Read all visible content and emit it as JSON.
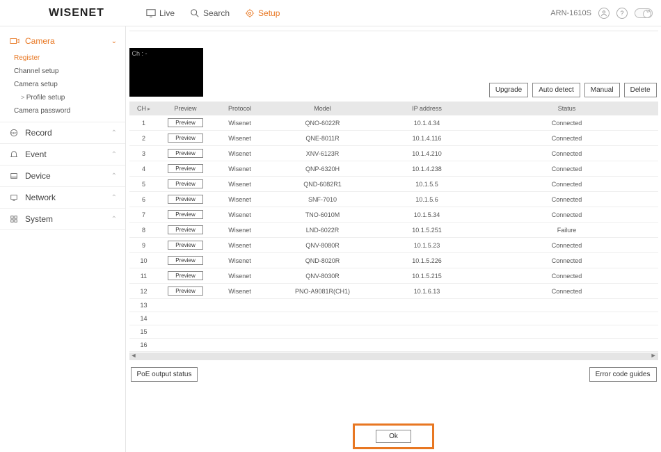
{
  "header": {
    "logo": "WISENET",
    "tabs": {
      "live": "Live",
      "search": "Search",
      "setup": "Setup"
    },
    "device": "ARN-1610S"
  },
  "sidebar": {
    "camera": {
      "label": "Camera",
      "register": "Register",
      "channel_setup": "Channel setup",
      "camera_setup": "Camera setup",
      "profile_setup": "Profile setup",
      "camera_password": "Camera password"
    },
    "record": "Record",
    "event": "Event",
    "device": "Device",
    "network": "Network",
    "system": "System"
  },
  "preview_box_label": "Ch : -",
  "toolbar": {
    "upgrade": "Upgrade",
    "auto_detect": "Auto detect",
    "manual": "Manual",
    "delete": "Delete"
  },
  "table": {
    "headers": {
      "ch": "CH",
      "preview": "Preview",
      "protocol": "Protocol",
      "model": "Model",
      "ip": "IP address",
      "status": "Status"
    },
    "preview_btn": "Preview",
    "rows": [
      {
        "ch": "1",
        "protocol": "Wisenet",
        "model": "QNO-6022R",
        "ip": "10.1.4.34",
        "status": "Connected"
      },
      {
        "ch": "2",
        "protocol": "Wisenet",
        "model": "QNE-8011R",
        "ip": "10.1.4.116",
        "status": "Connected"
      },
      {
        "ch": "3",
        "protocol": "Wisenet",
        "model": "XNV-6123R",
        "ip": "10.1.4.210",
        "status": "Connected"
      },
      {
        "ch": "4",
        "protocol": "Wisenet",
        "model": "QNP-6320H",
        "ip": "10.1.4.238",
        "status": "Connected"
      },
      {
        "ch": "5",
        "protocol": "Wisenet",
        "model": "QND-6082R1",
        "ip": "10.1.5.5",
        "status": "Connected"
      },
      {
        "ch": "6",
        "protocol": "Wisenet",
        "model": "SNF-7010",
        "ip": "10.1.5.6",
        "status": "Connected"
      },
      {
        "ch": "7",
        "protocol": "Wisenet",
        "model": "TNO-6010M",
        "ip": "10.1.5.34",
        "status": "Connected"
      },
      {
        "ch": "8",
        "protocol": "Wisenet",
        "model": "LND-6022R",
        "ip": "10.1.5.251",
        "status": "Failure"
      },
      {
        "ch": "9",
        "protocol": "Wisenet",
        "model": "QNV-8080R",
        "ip": "10.1.5.23",
        "status": "Connected"
      },
      {
        "ch": "10",
        "protocol": "Wisenet",
        "model": "QND-8020R",
        "ip": "10.1.5.226",
        "status": "Connected"
      },
      {
        "ch": "11",
        "protocol": "Wisenet",
        "model": "QNV-8030R",
        "ip": "10.1.5.215",
        "status": "Connected"
      },
      {
        "ch": "12",
        "protocol": "Wisenet",
        "model": "PNO-A9081R(CH1)",
        "ip": "10.1.6.13",
        "status": "Connected"
      }
    ],
    "empty_rows_start": 13,
    "empty_rows_end": 16
  },
  "bottom": {
    "poe": "PoE output status",
    "error_guides": "Error code guides",
    "ok": "Ok"
  }
}
